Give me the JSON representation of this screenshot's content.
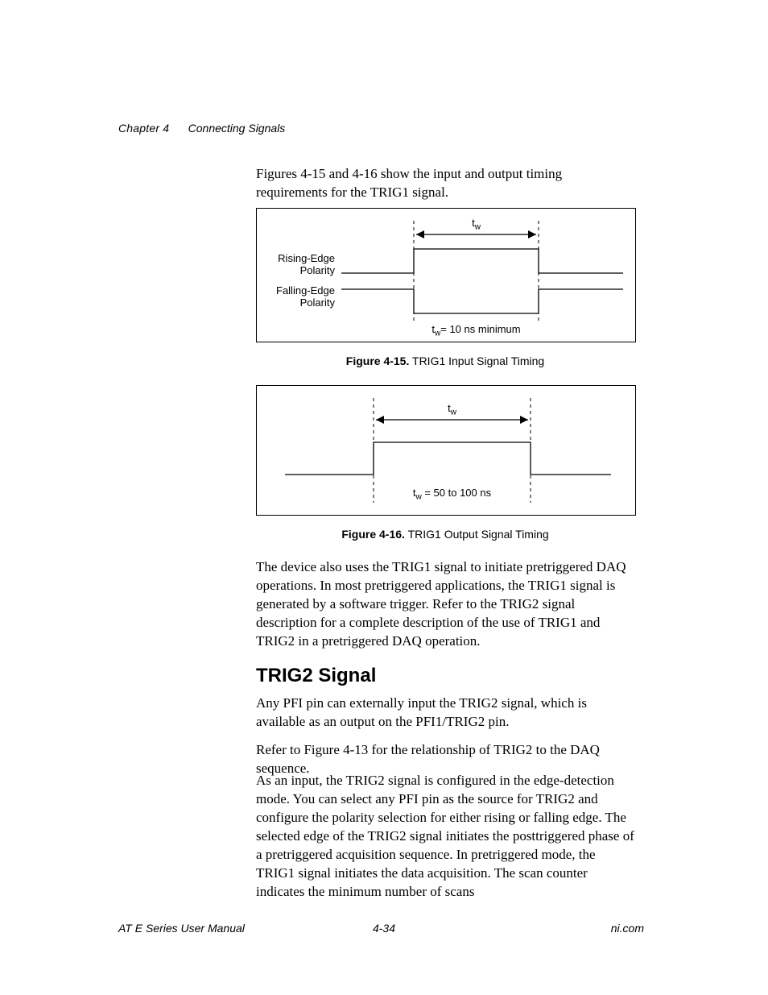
{
  "header": {
    "chapter": "Chapter 4",
    "title": "Connecting Signals"
  },
  "intro": "Figures 4-15 and 4-16 show the input and output timing requirements for the TRIG1 signal.",
  "fig15": {
    "label_rising": "Rising-Edge\nPolarity",
    "label_falling": "Falling-Edge\nPolarity",
    "tw": "t",
    "tw_sub": "w",
    "note_pre": "t",
    "note_sub": "w",
    "note_post": "= 10 ns minimum",
    "caption_bold": "Figure 4-15.",
    "caption_rest": "  TRIG1 Input Signal Timing"
  },
  "fig16": {
    "tw": "t",
    "tw_sub": "w",
    "note_pre": "t",
    "note_sub": "w",
    "note_post": " = 50 to 100 ns",
    "caption_bold": "Figure 4-16.",
    "caption_rest": "  TRIG1 Output Signal Timing"
  },
  "para2": "The device also uses the TRIG1 signal to initiate pretriggered DAQ operations. In most pretriggered applications, the TRIG1 signal is generated by a software trigger. Refer to the TRIG2 signal description for a complete description of the use of TRIG1 and TRIG2 in a pretriggered DAQ operation.",
  "section": "TRIG2 Signal",
  "para3": "Any PFI pin can externally input the TRIG2 signal, which is available as an output on the PFI1/TRIG2 pin.",
  "para4": "Refer to Figure 4-13 for the relationship of TRIG2 to the DAQ sequence.",
  "para5": "As an input, the TRIG2 signal is configured in the edge-detection mode. You can select any PFI pin as the source for TRIG2 and configure the polarity selection for either rising or falling edge. The selected edge of the TRIG2 signal initiates the posttriggered phase of a pretriggered acquisition sequence. In pretriggered mode, the TRIG1 signal initiates the data acquisition. The scan counter indicates the minimum number of scans",
  "footer": {
    "left": "AT E Series User Manual",
    "center": "4-34",
    "right": "ni.com"
  }
}
